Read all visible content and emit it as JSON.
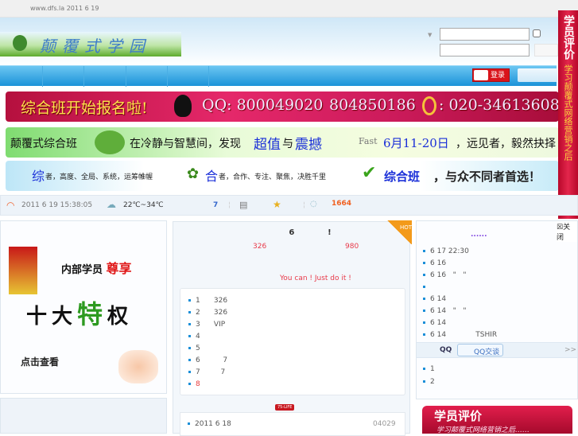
{
  "topbar": {
    "text": "www.dfs.la 2011 6 19"
  },
  "header": {
    "logo_text": "颠覆式学园"
  },
  "nav": {
    "weibo_login": "登录"
  },
  "side_banner": {
    "title": "学员评价",
    "subtitle": "学习颠覆式网络营销之后"
  },
  "banner1": {
    "a": "综合班开始报名啦!",
    "qq": "QQ: 800049020",
    "qq2": "804850186",
    "phone": ": 020-34613608"
  },
  "banner2": {
    "a": "颠覆式综合班",
    "b": "在冷静与智慧间，发现",
    "c": "超值",
    "d": "与",
    "e": "震撼",
    "fast": "Fast",
    "f": "6月11-20日",
    "g": "，远见者，毅然抉择"
  },
  "banner3": {
    "a1": "综",
    "a2": "者，高度、全局、系统，运筹帷幄",
    "b1": "合",
    "b2": "者，合作、专注、聚焦，决胜千里",
    "c1": "综合班",
    "c2": "，与众不同者首选！"
  },
  "infobar": {
    "datetime": "2011 6 19  15:38:05",
    "weather": "22℃~34℃",
    "count": "7",
    "visits": "1664"
  },
  "left_ad": {
    "line1": "内部学员",
    "line1b": "尊享",
    "line2a": "十大",
    "line2b": "特",
    "line2c": "权",
    "cta": "点击查看"
  },
  "middle": {
    "title": "6            !",
    "n1": "326",
    "n2": "980",
    "slogan": "You can ! Just do it !",
    "hot": "HOT",
    "items": [
      {
        "n": "1",
        "t": "326"
      },
      {
        "n": "2",
        "t": "326"
      },
      {
        "n": "3",
        "t": "VIP"
      },
      {
        "n": "4",
        "t": ""
      },
      {
        "n": "5",
        "t": ""
      },
      {
        "n": "6",
        "t": "7"
      },
      {
        "n": "7",
        "t": "7"
      },
      {
        "n": "8",
        "t": ""
      }
    ],
    "tag": "75-LIFE",
    "news_date": "2011  6 18",
    "news_num": "04029"
  },
  "right": {
    "close": "关闭",
    "title": "......",
    "items": [
      "6 17 22:30",
      "6 16",
      "6 16   \"   \"",
      "",
      "6 14",
      "6 14   \"   \"",
      "6 14",
      "6 14             TSHIR"
    ],
    "qq_label": "QQ",
    "qq_button": "QQ交谈",
    "more": ">>",
    "items2": [
      "1",
      "2"
    ]
  },
  "bottom_right": {
    "title": "学员评价",
    "subtitle": "学习颠覆式网络营销之后……"
  }
}
